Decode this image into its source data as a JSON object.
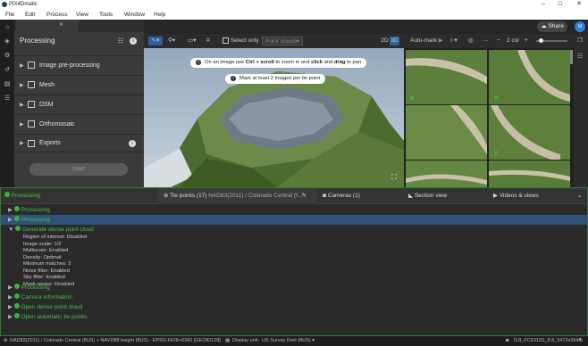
{
  "window": {
    "title": "PIX4Dmatic",
    "minimize": "–",
    "maximize": "☐",
    "close": "✕"
  },
  "menu": [
    "File",
    "Edit",
    "Process",
    "View",
    "Tools",
    "Window",
    "Help"
  ],
  "header": {
    "share_label": "Share",
    "avatar_initials": "M"
  },
  "left_panel": {
    "title": "Processing",
    "tab_close": "✕",
    "items": [
      {
        "label": "Image pre-processing"
      },
      {
        "label": "Mesh"
      },
      {
        "label": "DSM"
      },
      {
        "label": "Orthomosaic"
      },
      {
        "label": "Exports"
      }
    ],
    "start_label": "Start"
  },
  "toolbar": {
    "select_only_label": "Select only",
    "point_clouds_label": "Point clouds",
    "mode_2d": "2D",
    "mode_3d": "3D",
    "automark_label": "Auto-mark",
    "col_label": "2 col",
    "zoom_minus": "−",
    "zoom_plus": "+",
    "slider_fraction": 0.1
  },
  "tooltips": {
    "zoom_hint_prefix": "On an image use ",
    "zoom_hint_key": "Ctrl + scroll",
    "zoom_hint_mid": " to zoom in and ",
    "zoom_hint_click": "click",
    "zoom_hint_and": " and ",
    "zoom_hint_drag": "drag",
    "zoom_hint_suffix": " to pan",
    "mark_hint": "Mark at least 2 images per tie point"
  },
  "bottom": {
    "tab_tie_points": "Tie points (17)",
    "tab_tie_points_crs": "NAD83(2011) / Colorado Central (f...",
    "tab_cameras": "Cameras (1)",
    "tab_section": "Section view",
    "tab_videos": "Videos & views",
    "tree": [
      {
        "label": "Processing",
        "level": 0
      },
      {
        "label": "Processing",
        "level": 1
      },
      {
        "label": "Processing",
        "level": 1,
        "selected": true
      },
      {
        "label": "Generate dense point cloud",
        "level": 1
      }
    ],
    "details": [
      "Region of interest: Disabled",
      "Image scale: 1/2",
      "Multiscale: Enabled",
      "Density: Optimal",
      "Minimum matches: 3",
      "Noise filter: Enabled",
      "Sky filter: Enabled",
      "Mask-aware: Disabled"
    ],
    "tree_after": [
      {
        "label": "Processing"
      },
      {
        "label": "Camera information"
      },
      {
        "label": "Open dense point cloud"
      },
      {
        "label": "Open automatic tie points"
      }
    ]
  },
  "statusbar": {
    "crs": "NAD83(2011) / Colorado Central (ftUS) + NAVD88 height (ftUS) - EPSG:6428+6360 [GEOID128]",
    "display_unit_label": "Display unit:",
    "display_unit_value": "US Survey Feet (ftUS)",
    "camera": "DJI_FC6310S_8.8_5472x3648"
  },
  "colors": {
    "accent": "#2f7fd8",
    "success": "#3cb043",
    "selected_row": "#2e5278"
  }
}
